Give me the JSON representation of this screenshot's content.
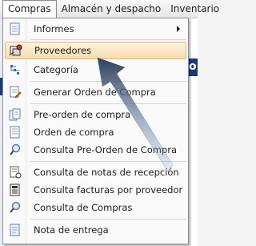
{
  "menubar": {
    "items": [
      "Compras",
      "Almacén y despacho",
      "Inventario"
    ],
    "active_index": 0
  },
  "background": {
    "right_band_text": "o"
  },
  "dropdown": {
    "items": [
      {
        "label": "Informes",
        "icon": "report-icon",
        "submenu": true
      },
      {
        "label": "Proveedores",
        "icon": "suppliers-icon",
        "highlighted": true
      },
      {
        "label": "Categoría",
        "icon": "category-icon"
      },
      {
        "label": "Generar Orden de Compra",
        "icon": "generate-order-icon"
      },
      {
        "label": "Pre-orden de compra",
        "icon": "pre-order-icon"
      },
      {
        "label": "Orden de compra",
        "icon": "purchase-order-icon"
      },
      {
        "label": "Consulta Pre-Orden de Compra",
        "icon": "search-icon"
      },
      {
        "label": "Consulta de notas de recepción",
        "icon": "reception-notes-icon"
      },
      {
        "label": "Consulta facturas por proveedor",
        "icon": "invoices-icon"
      },
      {
        "label": "Consulta de Compras",
        "icon": "search-icon"
      },
      {
        "label": "Nota de entrega",
        "icon": "delivery-note-icon"
      }
    ]
  },
  "colors": {
    "hover_background": "#f8dcab",
    "hover_border": "#e3b773",
    "app_band": "#173b7a",
    "pointer_arrow": "#2e3e5c"
  }
}
